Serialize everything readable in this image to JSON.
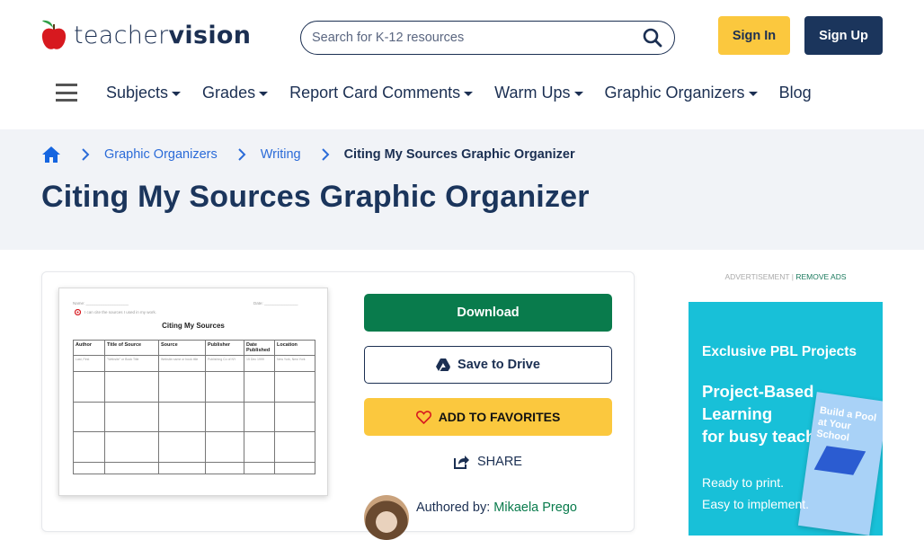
{
  "header": {
    "logo": {
      "light": "teacher",
      "bold": "vision"
    },
    "search_placeholder": "Search for K-12 resources",
    "sign_in": "Sign In",
    "sign_up": "Sign Up"
  },
  "nav": {
    "items": [
      {
        "label": "Subjects",
        "has_dropdown": true
      },
      {
        "label": "Grades",
        "has_dropdown": true
      },
      {
        "label": "Report Card Comments",
        "has_dropdown": true
      },
      {
        "label": "Warm Ups",
        "has_dropdown": true
      },
      {
        "label": "Graphic Organizers",
        "has_dropdown": true
      },
      {
        "label": "Blog",
        "has_dropdown": false
      }
    ]
  },
  "breadcrumb": {
    "items": [
      "Graphic Organizers",
      "Writing"
    ],
    "current": "Citing My Sources Graphic Organizer"
  },
  "page_title": "Citing My Sources Graphic Organizer",
  "worksheet": {
    "name_label": "Name: ___________________",
    "date_label": "Date: _______________",
    "objective": "I can cite the sources I used in my work.",
    "title": "Citing My Sources",
    "columns": [
      "Author",
      "Title of Source",
      "Source",
      "Publisher",
      "Date Published",
      "Location"
    ],
    "example_row": [
      "Last, First",
      "\"Website\" or Book Title",
      "Website name or book title",
      "Publishing Co of NY",
      "15 Dec 1999",
      "New York, New York"
    ]
  },
  "actions": {
    "download": "Download",
    "save_to_drive": "Save to Drive",
    "add_to_favorites": "ADD TO FAVORITES",
    "share": "SHARE"
  },
  "author": {
    "label": "Authored by:",
    "name": "Mikaela Prego"
  },
  "ad": {
    "label": "ADVERTISEMENT",
    "remove": "REMOVE ADS",
    "headline": "Exclusive PBL Projects",
    "subhead_1": "Project-Based",
    "subhead_2": "Learning",
    "subhead_3": "for busy teachers",
    "line_1": "Ready to print.",
    "line_2": "Easy to implement.",
    "book_title": "Build a Pool at Your School"
  },
  "colors": {
    "brand_navy": "#1b355c",
    "accent_yellow": "#fbc83e",
    "download_green": "#097b4c",
    "link_blue": "#2b6bd8",
    "ad_cyan": "#18c0d8"
  }
}
